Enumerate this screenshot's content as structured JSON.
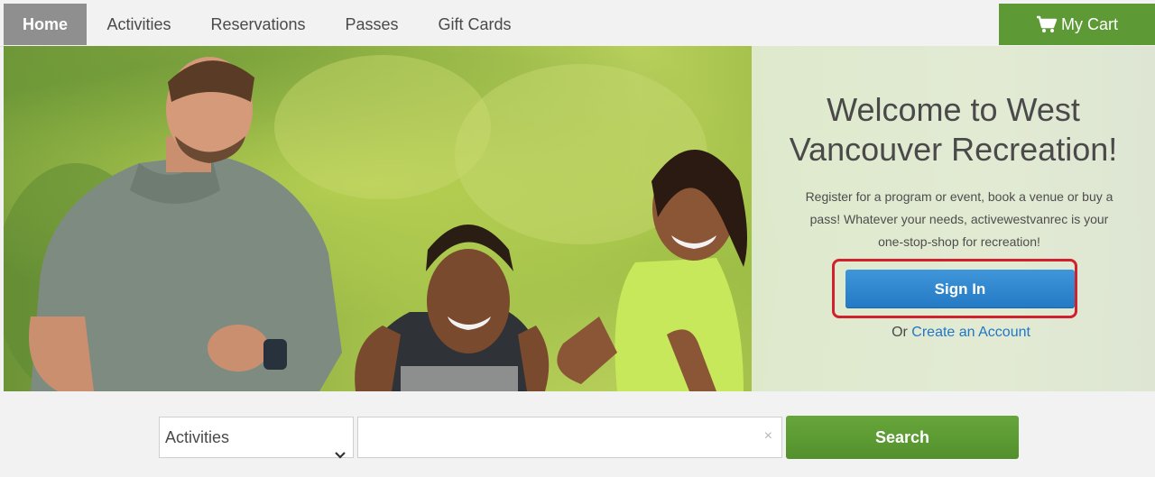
{
  "nav": {
    "items": [
      {
        "label": "Home",
        "active": true
      },
      {
        "label": "Activities"
      },
      {
        "label": "Reservations"
      },
      {
        "label": "Passes"
      },
      {
        "label": "Gift Cards"
      }
    ],
    "cart_label": "My Cart",
    "cart_icon": "shopping-cart-icon"
  },
  "hero": {
    "welcome_line1": "Welcome to West",
    "welcome_line2": "Vancouver Recreation!",
    "blurb_line1": "Register for a program or event, book a venue or buy a",
    "blurb_line2": "pass! Whatever your needs, activewestvanrec is your",
    "blurb_line3": "one-stop-shop for recreation!",
    "signin_label": "Sign In",
    "or_text": "Or",
    "create_account_link": "Create an Account"
  },
  "search": {
    "category_value": "Activities",
    "input_value": "",
    "clear_symbol": "×",
    "button_label": "Search"
  },
  "colors": {
    "brand_green": "#5d9a36",
    "primary_blue": "#2479c4",
    "highlight_red": "#d0212d",
    "active_tab_gray": "#8f8f8f"
  }
}
